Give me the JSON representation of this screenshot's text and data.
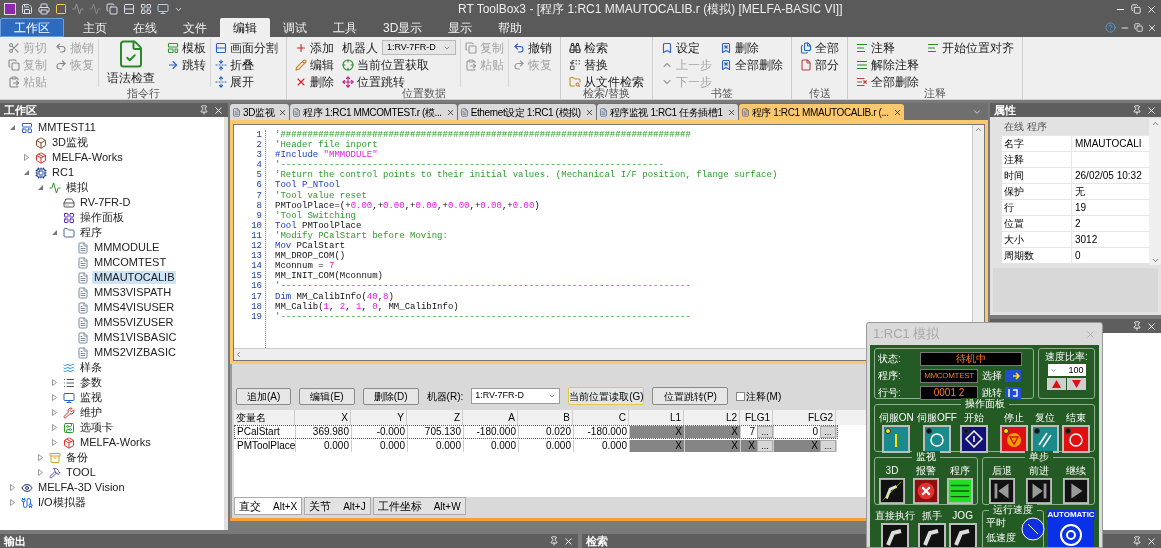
{
  "window": {
    "title": "RT ToolBox3 - [程序 1:RC1 MMAUTOCALIB.r (模拟)   [MELFA-BASIC VI]]"
  },
  "ribbon": {
    "tabs": [
      {
        "label": "工作区",
        "kind": "app",
        "selected": false
      },
      {
        "label": "主页",
        "kind": "tab",
        "selected": false
      },
      {
        "label": "在线",
        "kind": "tab",
        "selected": false
      },
      {
        "label": "文件",
        "kind": "tab",
        "selected": false
      },
      {
        "label": "编辑",
        "kind": "tab",
        "selected": true
      },
      {
        "label": "调试",
        "kind": "tab",
        "selected": false
      },
      {
        "label": "工具",
        "kind": "tab",
        "selected": false
      },
      {
        "label": "3D显示",
        "kind": "tab",
        "selected": false
      },
      {
        "label": "显示",
        "kind": "tab",
        "selected": false
      },
      {
        "label": "帮助",
        "kind": "tab",
        "selected": false
      }
    ],
    "groups": [
      {
        "label": "指令行",
        "sections": [
          [
            [
              {
                "label": "剪切",
                "kind": "small",
                "disabled": true
              },
              {
                "label": "复制",
                "kind": "small",
                "disabled": true
              },
              {
                "label": "粘贴",
                "kind": "small",
                "disabled": true
              }
            ],
            [
              {
                "label": "撤销",
                "kind": "small",
                "disabled": true
              },
              {
                "label": "恢复",
                "kind": "small",
                "disabled": true
              }
            ]
          ],
          [
            [
              {
                "label": "语法检查",
                "kind": "large",
                "disabled": false
              }
            ],
            [
              {
                "label": "模板",
                "kind": "small",
                "disabled": false
              },
              {
                "label": "跳转",
                "kind": "small",
                "disabled": false
              }
            ]
          ],
          [
            [
              {
                "label": "画面分割",
                "kind": "small",
                "disabled": false
              },
              {
                "label": "折叠",
                "kind": "small",
                "disabled": false
              },
              {
                "label": "展开",
                "kind": "small",
                "disabled": false
              }
            ]
          ]
        ]
      },
      {
        "label": "位置数据",
        "sections": [
          [
            [
              {
                "label": "添加",
                "kind": "small",
                "disabled": false
              },
              {
                "label": "编辑",
                "kind": "small",
                "disabled": false
              },
              {
                "label": "删除",
                "kind": "small",
                "disabled": false
              }
            ],
            [
              {
                "label": "机器人",
                "kind": "combo",
                "value": "1:RV-7FR-D",
                "disabled": false
              },
              {
                "label": "当前位置获取",
                "kind": "small",
                "disabled": false
              },
              {
                "label": "位置跳转",
                "kind": "small",
                "disabled": false
              }
            ]
          ],
          [
            [
              {
                "label": "复制",
                "kind": "small",
                "disabled": true
              },
              {
                "label": "粘贴",
                "kind": "small",
                "disabled": true
              }
            ]
          ],
          [
            [
              {
                "label": "撤销",
                "kind": "small",
                "disabled": false
              },
              {
                "label": "恢复",
                "kind": "small",
                "disabled": true
              }
            ]
          ]
        ]
      },
      {
        "label": "检索/替换",
        "sections": [
          [
            [
              {
                "label": "检索",
                "kind": "small",
                "disabled": false
              },
              {
                "label": "替换",
                "kind": "small",
                "disabled": false
              },
              {
                "label": "从文件检索",
                "kind": "small",
                "disabled": false
              }
            ]
          ]
        ]
      },
      {
        "label": "书签",
        "sections": [
          [
            [
              {
                "label": "设定",
                "kind": "small",
                "disabled": false
              },
              {
                "label": "上一步",
                "kind": "small",
                "disabled": true
              },
              {
                "label": "下一步",
                "kind": "small",
                "disabled": true
              }
            ],
            [
              {
                "label": "删除",
                "kind": "small",
                "disabled": false
              },
              {
                "label": "全部删除",
                "kind": "small",
                "disabled": false
              }
            ]
          ]
        ]
      },
      {
        "label": "传送",
        "sections": [
          [
            [
              {
                "label": "全部",
                "kind": "small",
                "disabled": false
              },
              {
                "label": "部分",
                "kind": "small",
                "disabled": false
              }
            ]
          ]
        ]
      },
      {
        "label": "注释",
        "sections": [
          [
            [
              {
                "label": "注释",
                "kind": "small",
                "disabled": false
              },
              {
                "label": "解除注释",
                "kind": "small",
                "disabled": false
              },
              {
                "label": "全部删除",
                "kind": "small",
                "disabled": false
              }
            ],
            [
              {
                "label": "开始位置对齐",
                "kind": "small",
                "disabled": false
              }
            ]
          ]
        ]
      }
    ]
  },
  "workspace": {
    "title": "工作区",
    "tree": [
      {
        "label": "MMTEST11",
        "kind": "project",
        "expanded": true,
        "selected": false,
        "children": [
          {
            "label": "3D监视",
            "kind": "monitor3d",
            "selected": false
          },
          {
            "label": "MELFA-Works",
            "kind": "works",
            "expanded": false,
            "selected": false
          },
          {
            "label": "RC1",
            "kind": "controller",
            "expanded": true,
            "selected": false,
            "children": [
              {
                "label": "模拟",
                "kind": "simulation",
                "expanded": true,
                "selected": false,
                "children": [
                  {
                    "label": "RV-7FR-D",
                    "kind": "robot",
                    "selected": false
                  },
                  {
                    "label": "操作面板",
                    "kind": "panel",
                    "selected": false
                  },
                  {
                    "label": "程序",
                    "kind": "folder",
                    "expanded": true,
                    "selected": false,
                    "children": [
                      {
                        "label": "MMMODULE",
                        "kind": "program",
                        "selected": false
                      },
                      {
                        "label": "MMCOMTEST",
                        "kind": "program",
                        "selected": false
                      },
                      {
                        "label": "MMAUTOCALIB",
                        "kind": "program",
                        "selected": true
                      },
                      {
                        "label": "MMS3VISPATH",
                        "kind": "program",
                        "selected": false
                      },
                      {
                        "label": "MMS4VISUSER",
                        "kind": "program",
                        "selected": false
                      },
                      {
                        "label": "MMS5VIZUSER",
                        "kind": "program",
                        "selected": false
                      },
                      {
                        "label": "MMS1VISBASIC",
                        "kind": "program",
                        "selected": false
                      },
                      {
                        "label": "MMS2VIZBASIC",
                        "kind": "program",
                        "selected": false
                      }
                    ]
                  },
                  {
                    "label": "样条",
                    "kind": "spline",
                    "selected": false
                  },
                  {
                    "label": "参数",
                    "kind": "params",
                    "expanded": false,
                    "selected": false
                  },
                  {
                    "label": "监视",
                    "kind": "monitor",
                    "expanded": false,
                    "selected": false
                  },
                  {
                    "label": "维护",
                    "kind": "maintenance",
                    "expanded": false,
                    "selected": false
                  },
                  {
                    "label": "选项卡",
                    "kind": "option",
                    "expanded": false,
                    "selected": false
                  },
                  {
                    "label": "MELFA-Works",
                    "kind": "works",
                    "expanded": false,
                    "selected": false
                  }
                ]
              },
              {
                "label": "备份",
                "kind": "backup",
                "expanded": false,
                "selected": false
              },
              {
                "label": "TOOL",
                "kind": "tool",
                "expanded": false,
                "selected": false
              }
            ]
          }
        ]
      },
      {
        "label": "MELFA-3D Vision",
        "kind": "vision",
        "expanded": false,
        "selected": false
      },
      {
        "label": "I/O模拟器",
        "kind": "io",
        "expanded": false,
        "selected": false
      }
    ]
  },
  "document_tabs": [
    {
      "label": "3D监视",
      "selected": false
    },
    {
      "label": "程序 1:RC1 MMCOMTEST.r (模...",
      "selected": false
    },
    {
      "label": "Ethernet设定 1:RC1 (模拟)",
      "selected": false
    },
    {
      "label": "程序监视 1:RC1 任务插槽1",
      "selected": false
    },
    {
      "label": "程序 1:RC1 MMAUTOCALIB.r (...",
      "selected": true
    }
  ],
  "editor": {
    "lines": [
      {
        "number": "1",
        "segments": [
          {
            "kind": "comment",
            "text": "'############################################################################"
          }
        ]
      },
      {
        "number": "2",
        "segments": [
          {
            "kind": "comment",
            "text": "'Header file inport"
          }
        ]
      },
      {
        "number": "3",
        "segments": [
          {
            "kind": "keyword",
            "text": "#Include "
          },
          {
            "kind": "string",
            "text": "\"MMMODULE\""
          }
        ]
      },
      {
        "number": "4",
        "segments": [
          {
            "kind": "comment",
            "text": "'-----------------------------------------------------------------------"
          }
        ]
      },
      {
        "number": "5",
        "segments": [
          {
            "kind": "comment",
            "text": "'Return the control points to their initial values. (Mechanical I/F position, flange surface)"
          }
        ]
      },
      {
        "number": "6",
        "segments": [
          {
            "kind": "keyword",
            "text": "Tool P_NTool"
          }
        ]
      },
      {
        "number": "7",
        "segments": [
          {
            "kind": "comment",
            "text": "'Tool value reset"
          }
        ]
      },
      {
        "number": "8",
        "segments": [
          {
            "kind": "plain",
            "text": "PMToolPlace=(+"
          },
          {
            "kind": "number",
            "text": "0.00"
          },
          {
            "kind": "plain",
            "text": ",+"
          },
          {
            "kind": "number",
            "text": "0.00"
          },
          {
            "kind": "plain",
            "text": ",+"
          },
          {
            "kind": "number",
            "text": "0.00"
          },
          {
            "kind": "plain",
            "text": ",+"
          },
          {
            "kind": "number",
            "text": "0.00"
          },
          {
            "kind": "plain",
            "text": ",+"
          },
          {
            "kind": "number",
            "text": "0.00"
          },
          {
            "kind": "plain",
            "text": ",+"
          },
          {
            "kind": "number",
            "text": "0.00"
          },
          {
            "kind": "plain",
            "text": ")"
          }
        ]
      },
      {
        "number": "9",
        "segments": [
          {
            "kind": "comment",
            "text": "'Tool Switching"
          }
        ]
      },
      {
        "number": "10",
        "segments": [
          {
            "kind": "keyword",
            "text": "Tool"
          },
          {
            "kind": "plain",
            "text": " PMToolPlace"
          }
        ]
      },
      {
        "number": "11",
        "segments": [
          {
            "kind": "comment",
            "text": "'Modify PCalStart before Moving:"
          }
        ]
      },
      {
        "number": "12",
        "segments": [
          {
            "kind": "keyword",
            "text": "Mov"
          },
          {
            "kind": "plain",
            "text": " PCalStart"
          }
        ]
      },
      {
        "number": "13",
        "segments": [
          {
            "kind": "plain",
            "text": "MM_DROP_COM()"
          }
        ]
      },
      {
        "number": "14",
        "segments": [
          {
            "kind": "plain",
            "text": "Mconnum = "
          },
          {
            "kind": "number",
            "text": "7"
          }
        ]
      },
      {
        "number": "15",
        "segments": [
          {
            "kind": "plain",
            "text": "MM_INIT_COM(Mconnum)"
          }
        ]
      },
      {
        "number": "16",
        "segments": [
          {
            "kind": "comment",
            "text": "'----------------------------------------------------------------------------"
          }
        ]
      },
      {
        "number": "17",
        "segments": [
          {
            "kind": "keyword",
            "text": "Dim"
          },
          {
            "kind": "plain",
            "text": " MM_CalibInfo("
          },
          {
            "kind": "number",
            "text": "40"
          },
          {
            "kind": "plain",
            "text": ","
          },
          {
            "kind": "number",
            "text": "8"
          },
          {
            "kind": "plain",
            "text": ")"
          }
        ]
      },
      {
        "number": "18",
        "segments": [
          {
            "kind": "plain",
            "text": "MM_Calib("
          },
          {
            "kind": "number",
            "text": "1"
          },
          {
            "kind": "plain",
            "text": ", "
          },
          {
            "kind": "number",
            "text": "2"
          },
          {
            "kind": "plain",
            "text": ", "
          },
          {
            "kind": "number",
            "text": "1"
          },
          {
            "kind": "plain",
            "text": ", "
          },
          {
            "kind": "number",
            "text": "0"
          },
          {
            "kind": "plain",
            "text": ", MM_CalibInfo)"
          }
        ]
      },
      {
        "number": "19",
        "segments": [
          {
            "kind": "comment",
            "text": "'----------------------------------------------------------------------------"
          }
        ]
      }
    ]
  },
  "position_data": {
    "buttons": [
      {
        "label": "追加(A)",
        "focused": false
      },
      {
        "label": "编辑(E)",
        "focused": false
      },
      {
        "label": "删除(D)",
        "focused": false
      }
    ],
    "robot_label": "机器(R):",
    "robot_value": "1:RV-7FR-D",
    "actions": [
      {
        "label": "当前位置读取(G)",
        "focused": true
      },
      {
        "label": "位置跳转(P)",
        "focused": false
      }
    ],
    "comment_checkbox": {
      "label": "注释(M)",
      "checked": false
    },
    "columns": [
      "变量名",
      "X",
      "Y",
      "Z",
      "A",
      "B",
      "C",
      "L1",
      "L2",
      "FLG1",
      "FLG2"
    ],
    "rows": [
      {
        "selected": true,
        "cells": [
          {
            "text": "PCalStart",
            "disabled": false
          },
          {
            "text": "369.980",
            "disabled": false
          },
          {
            "text": "-0.000",
            "disabled": false
          },
          {
            "text": "705.130",
            "disabled": false
          },
          {
            "text": "-180.000",
            "disabled": false
          },
          {
            "text": "0.020",
            "disabled": false
          },
          {
            "text": "-180.000",
            "disabled": false
          },
          {
            "text": "X",
            "disabled": true
          },
          {
            "text": "X",
            "disabled": true
          },
          {
            "text": "7",
            "disabled": false,
            "button": "..."
          },
          {
            "text": "0",
            "disabled": false,
            "button": "..."
          }
        ]
      },
      {
        "selected": false,
        "cells": [
          {
            "text": "PMToolPlace",
            "disabled": false
          },
          {
            "text": "0.000",
            "disabled": false
          },
          {
            "text": "0.000",
            "disabled": false
          },
          {
            "text": "0.000",
            "disabled": false
          },
          {
            "text": "0.000",
            "disabled": false
          },
          {
            "text": "0.000",
            "disabled": false
          },
          {
            "text": "0.000",
            "disabled": false
          },
          {
            "text": "X",
            "disabled": true
          },
          {
            "text": "X",
            "disabled": true
          },
          {
            "text": "X",
            "disabled": true,
            "button": "..."
          },
          {
            "text": "X",
            "disabled": true,
            "button": "..."
          }
        ]
      }
    ],
    "tabs": [
      {
        "label": "直交",
        "shortcut": "Alt+X",
        "selected": true
      },
      {
        "label": "关节",
        "shortcut": "Alt+J",
        "selected": false
      },
      {
        "label": "工件坐标",
        "shortcut": "Alt+W",
        "selected": false
      }
    ]
  },
  "properties": {
    "title": "属性",
    "category": "在线 程序",
    "rows": [
      {
        "name": "名字",
        "value": "MMAUTOCALI"
      },
      {
        "name": "注释"
      },
      {
        "name": "时间",
        "value": "26/02/05 10:32"
      },
      {
        "name": "保护",
        "value": "无"
      },
      {
        "name": "行",
        "value": "19"
      },
      {
        "name": "位置",
        "value": "2"
      },
      {
        "name": "大小",
        "value": "3012"
      },
      {
        "name": "周期数",
        "value": "0"
      }
    ]
  },
  "bottom_panels": [
    {
      "title": "输出"
    },
    {
      "title": "检索"
    }
  ],
  "operation_panel": {
    "title": "1:RC1 模拟",
    "status": {
      "state_label": "状态:",
      "state": "待机中",
      "program_label": "程序:",
      "program": "MMCOMTEST",
      "select": "选择",
      "line_label": "行号:",
      "line": "0001 2",
      "jump": "跳转"
    },
    "speed": {
      "title": "速度比率:",
      "value": "100"
    },
    "operation": {
      "title": "操作面板",
      "buttons": [
        {
          "label": "伺服ON",
          "lamp_on": true
        },
        {
          "label": "伺服OFF",
          "lamp_on": false
        },
        {
          "label": "开始",
          "lamp_on": false
        },
        {
          "label": "停止",
          "lamp_on": true
        },
        {
          "label": "复位",
          "lamp_on": false
        },
        {
          "label": "结束",
          "lamp_on": false
        }
      ]
    },
    "monitor": {
      "title": "监视",
      "buttons": [
        "3D",
        "报警",
        "程序"
      ]
    },
    "step": {
      "title": "单步",
      "buttons": [
        "后退",
        "前进",
        "继续"
      ]
    },
    "tools": [
      "直接执行",
      "抓手",
      "JOG"
    ],
    "run_speed": {
      "title": "运行速度",
      "options": [
        "平时",
        "低速度"
      ]
    },
    "automatic": "AUTOMATIC"
  }
}
